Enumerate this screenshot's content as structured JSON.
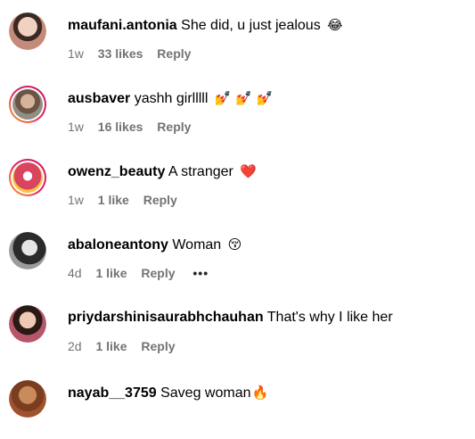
{
  "comments": [
    {
      "username": "maufani.antonia",
      "text": "She did, u just jealous",
      "emoji": "😂",
      "time": "1w",
      "likes": "33 likes",
      "reply": "Reply",
      "avatar_color": "#c48b7a",
      "story_ring": false
    },
    {
      "username": "ausbaver",
      "text": "yashh girlllll",
      "emoji": "💅 💅 💅",
      "time": "1w",
      "likes": "16 likes",
      "reply": "Reply",
      "avatar_color": "#8a6f5a",
      "story_ring": true
    },
    {
      "username": "owenz_beauty",
      "text": "A stranger",
      "emoji": "❤️",
      "time": "1w",
      "likes": "1 like",
      "reply": "Reply",
      "avatar_color": "#d9455f",
      "story_ring": true
    },
    {
      "username": "abaloneantony",
      "text": "Woman",
      "emoji": "😚",
      "time": "4d",
      "likes": "1 like",
      "reply": "Reply",
      "more": "•••",
      "avatar_color": "#555555",
      "story_ring": false
    },
    {
      "username": "priydarshinisaurabhchauhan",
      "text": "That's why I like her",
      "emoji": "",
      "time": "2d",
      "likes": "1 like",
      "reply": "Reply",
      "avatar_color": "#b5566b",
      "story_ring": false
    },
    {
      "username": "nayab__3759",
      "text": "Saveg woman",
      "emoji": "🔥",
      "time": "",
      "likes": "",
      "reply": "",
      "avatar_color": "#a0522d",
      "story_ring": false
    }
  ]
}
